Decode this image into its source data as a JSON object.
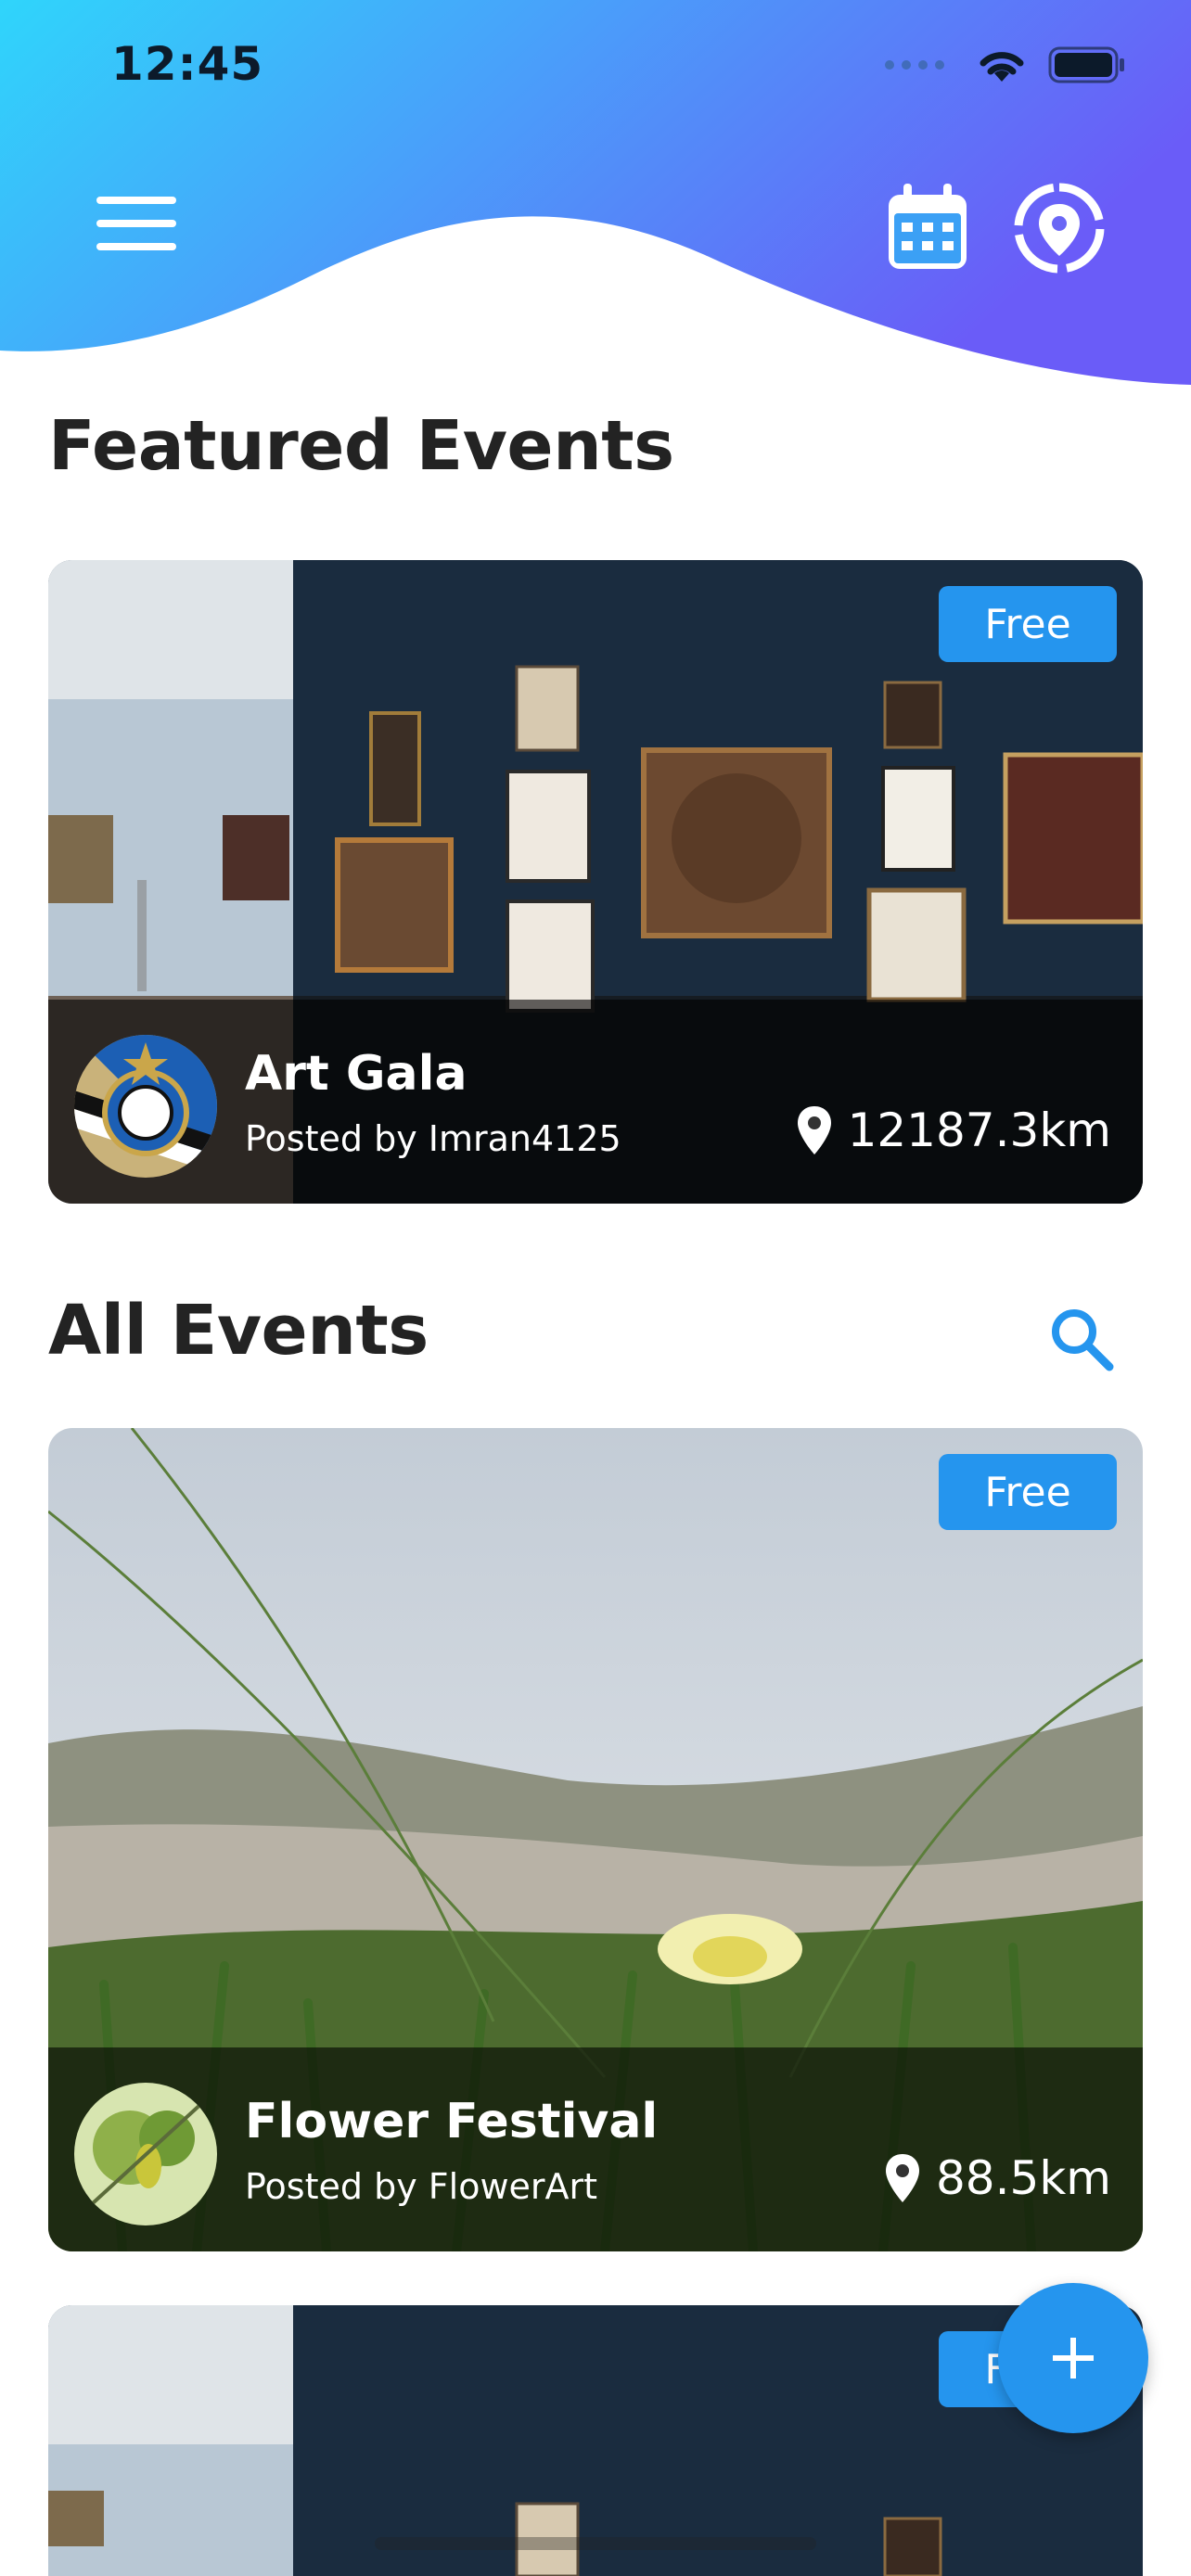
{
  "status_bar": {
    "time": "12:45"
  },
  "colors": {
    "gradient_start": "#2fd5fb",
    "gradient_end": "#6a5cf8",
    "accent": "#2595ee"
  },
  "header": {
    "menu_icon": "hamburger-menu-icon",
    "calendar_icon": "calendar-icon",
    "location_icon": "location-target-icon"
  },
  "featured": {
    "title": "Featured Events",
    "event": {
      "badge": "Free",
      "name": "Art Gala",
      "posted_by": "Posted by Imran4125",
      "distance": "12187.3km"
    }
  },
  "all_events": {
    "title": "All Events",
    "search_icon": "search-icon",
    "events": [
      {
        "badge": "Free",
        "name": "Flower Festival",
        "posted_by": "Posted by FlowerArt",
        "distance": "88.5km"
      },
      {
        "badge": "Free",
        "name": "",
        "posted_by": "",
        "distance": ""
      }
    ]
  },
  "fab_icon": "plus-icon"
}
